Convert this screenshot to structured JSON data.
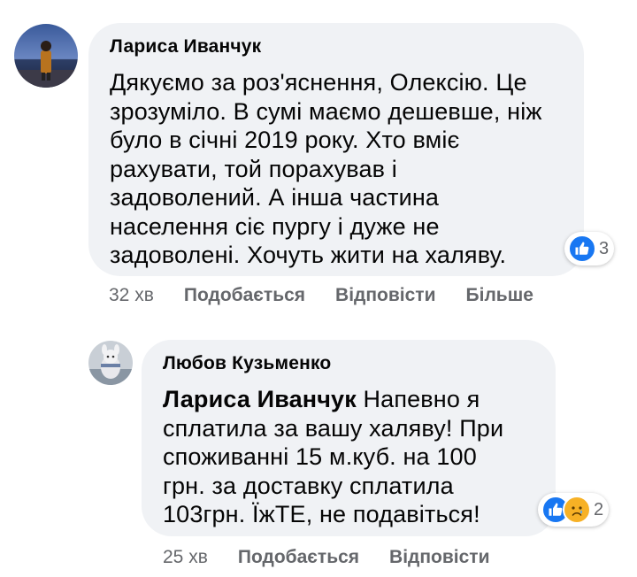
{
  "comments": [
    {
      "author": "Лариса Иванчук",
      "lines": [
        "Дякуємо за роз'яснення, Олексію. Це",
        "зрозуміло. В сумі маємо дешевше, ніж",
        "було в січні 2019 року. Хто вміє",
        "рахувати, той порахував і",
        "задоволений. А інша частина",
        "населення сіє пургу і дуже не",
        "задоволені. Хочуть жити на халяву."
      ],
      "reaction_count": "3",
      "reaction_icons": [
        "like-icon"
      ],
      "time": "32 хв",
      "like_label": "Подобається",
      "reply_label": "Відповісти",
      "more_label": "Більше"
    },
    {
      "author": "Любов Кузьменко",
      "mention": "Лариса Иванчук",
      "first_line_rest": " Напевно я",
      "lines": [
        "сплатила за вашу халяву! При",
        "споживанні 15 м.куб. на 100",
        "грн. за доставку сплатила",
        "103грн. ЇжТЕ, не подавіться!"
      ],
      "reaction_count": "2",
      "reaction_icons": [
        "like-icon",
        "sad-icon"
      ],
      "time": "25 хв",
      "like_label": "Подобається",
      "reply_label": "Відповісти"
    }
  ],
  "colors": {
    "bubble": "#f0f2f5",
    "like": "#1877f2",
    "sad": "#f7b125",
    "secondary_text": "#65676b"
  }
}
